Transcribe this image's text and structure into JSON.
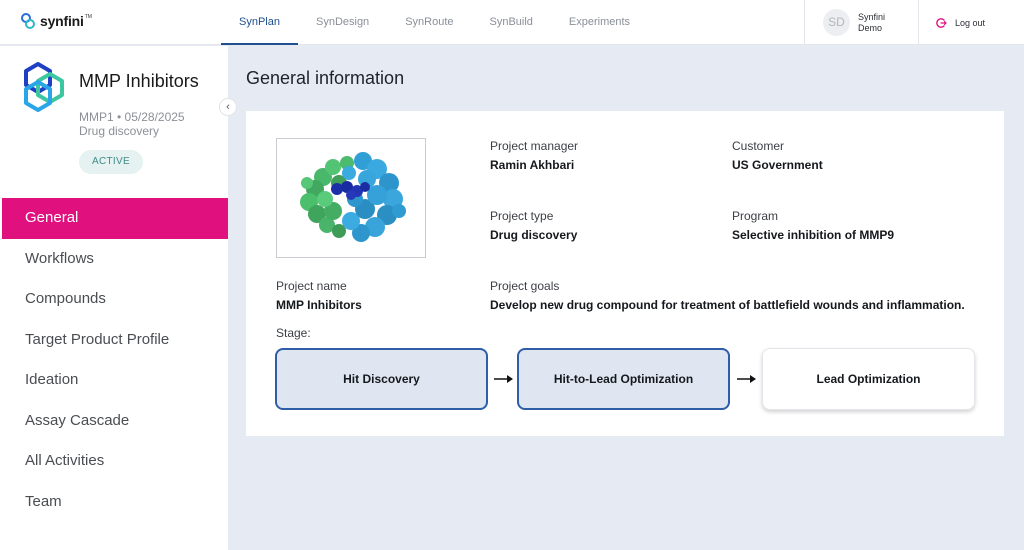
{
  "brand": {
    "name": "synfini",
    "tm": "TM"
  },
  "nav_tabs": [
    {
      "label": "SynPlan"
    },
    {
      "label": "SynDesign"
    },
    {
      "label": "SynRoute"
    },
    {
      "label": "SynBuild"
    },
    {
      "label": "Experiments"
    }
  ],
  "user": {
    "initials": "SD",
    "name_line1": "Synfini",
    "name_line2": "Demo"
  },
  "logout_label": "Log out",
  "project": {
    "title": "MMP Inhibitors",
    "meta_line1": "MMP1 • 05/28/2025",
    "meta_line2": "Drug discovery",
    "status": "ACTIVE"
  },
  "sidebar": {
    "collapse_glyph": "‹",
    "items": [
      {
        "label": "General"
      },
      {
        "label": "Workflows"
      },
      {
        "label": "Compounds"
      },
      {
        "label": "Target Product Profile"
      },
      {
        "label": "Ideation"
      },
      {
        "label": "Assay Cascade"
      },
      {
        "label": "All Activities"
      },
      {
        "label": "Team"
      }
    ]
  },
  "main": {
    "title": "General information",
    "fields": {
      "project_manager": {
        "label": "Project manager",
        "value": "Ramin Akhbari"
      },
      "customer": {
        "label": "Customer",
        "value": "US Government"
      },
      "project_type": {
        "label": "Project type",
        "value": "Drug discovery"
      },
      "program": {
        "label": "Program",
        "value": "Selective inhibition of MMP9"
      },
      "project_name": {
        "label": "Project name",
        "value": "MMP Inhibitors"
      },
      "project_goals": {
        "label": "Project goals",
        "value": "Develop new drug compound for treatment of battlefield wounds and inflammation."
      }
    },
    "stage_label": "Stage:",
    "stages": [
      {
        "label": "Hit Discovery"
      },
      {
        "label": "Hit-to-Lead Optimization"
      },
      {
        "label": "Lead Optimization"
      }
    ]
  },
  "colors": {
    "accent": "#e0117f",
    "tab_active": "#1f4f8f",
    "stage_border": "#2f5ea8",
    "stage_fill": "#dfe6f1",
    "badge_text": "#3f8a8a"
  },
  "icons": [
    "synfini-logo-icon",
    "project-hexagon-icon",
    "collapse-chevron-icon",
    "logout-icon",
    "protein-structure-image",
    "arrow-right-icon"
  ]
}
